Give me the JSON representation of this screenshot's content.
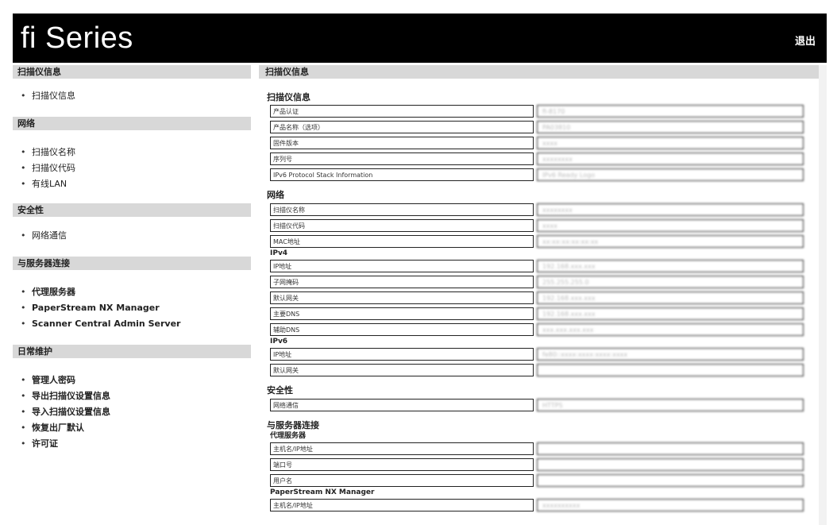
{
  "header": {
    "logo": "fi Series",
    "logout": "退出"
  },
  "sidebar": {
    "sections": [
      {
        "title": "扫描仪信息",
        "items": [
          "扫描仪信息"
        ]
      },
      {
        "title": "网络",
        "items": [
          "扫描仪名称",
          "扫描仪代码",
          "有线LAN"
        ]
      },
      {
        "title": "安全性",
        "items": [
          "网络通信"
        ]
      },
      {
        "title": "与服务器连接",
        "items": [
          "代理服务器",
          "PaperStream NX Manager",
          "Scanner Central Admin Server"
        ]
      },
      {
        "title": "日常维护",
        "items": [
          "管理人密码",
          "导出扫描仪设置信息",
          "导入扫描仪设置信息",
          "恢复出厂默认",
          "许可证"
        ]
      }
    ]
  },
  "main": {
    "title": "扫描仪信息",
    "groups": {
      "basic": {
        "title": "扫描仪信息",
        "rows": [
          {
            "label": "产品认证",
            "value": "fi-8170"
          },
          {
            "label": "产品名称（选项）",
            "value": "PA03810"
          },
          {
            "label": "固件版本",
            "value": "xxxx"
          },
          {
            "label": "序列号",
            "value": "xxxxxxxx"
          },
          {
            "label": "IPv6 Protocol Stack Information",
            "value": "IPv6 Ready Logo"
          }
        ]
      },
      "network": {
        "title": "网络",
        "rows": [
          {
            "label": "扫描仪名称",
            "value": "xxxxxxxx"
          },
          {
            "label": "扫描仪代码",
            "value": "xxxx"
          },
          {
            "label": "MAC地址",
            "value": "xx:xx:xx:xx:xx:xx"
          }
        ],
        "ipv4_title": "IPv4",
        "ipv4": [
          {
            "label": "IP地址",
            "value": "192.168.xxx.xxx"
          },
          {
            "label": "子网掩码",
            "value": "255.255.255.0"
          },
          {
            "label": "默认网关",
            "value": "192.168.xxx.xxx"
          },
          {
            "label": "主要DNS",
            "value": "192.168.xxx.xxx"
          },
          {
            "label": "辅助DNS",
            "value": "xxx.xxx.xxx.xxx"
          }
        ],
        "ipv6_title": "IPv6",
        "ipv6": [
          {
            "label": "IP地址",
            "value": "fe80::xxxx:xxxx:xxxx:xxxx"
          },
          {
            "label": "默认网关",
            "value": ""
          }
        ]
      },
      "security": {
        "title": "安全性",
        "rows": [
          {
            "label": "网络通信",
            "value": "HTTPS"
          }
        ]
      },
      "server": {
        "title": "与服务器连接",
        "proxy_title": "代理服务器",
        "proxy": [
          {
            "label": "主机名/IP地址",
            "value": ""
          },
          {
            "label": "端口号",
            "value": ""
          },
          {
            "label": "用户名",
            "value": ""
          }
        ],
        "nx_title": "PaperStream NX Manager",
        "nx": [
          {
            "label": "主机名/IP地址",
            "value": "xxxxxxxxxx"
          }
        ]
      }
    }
  }
}
